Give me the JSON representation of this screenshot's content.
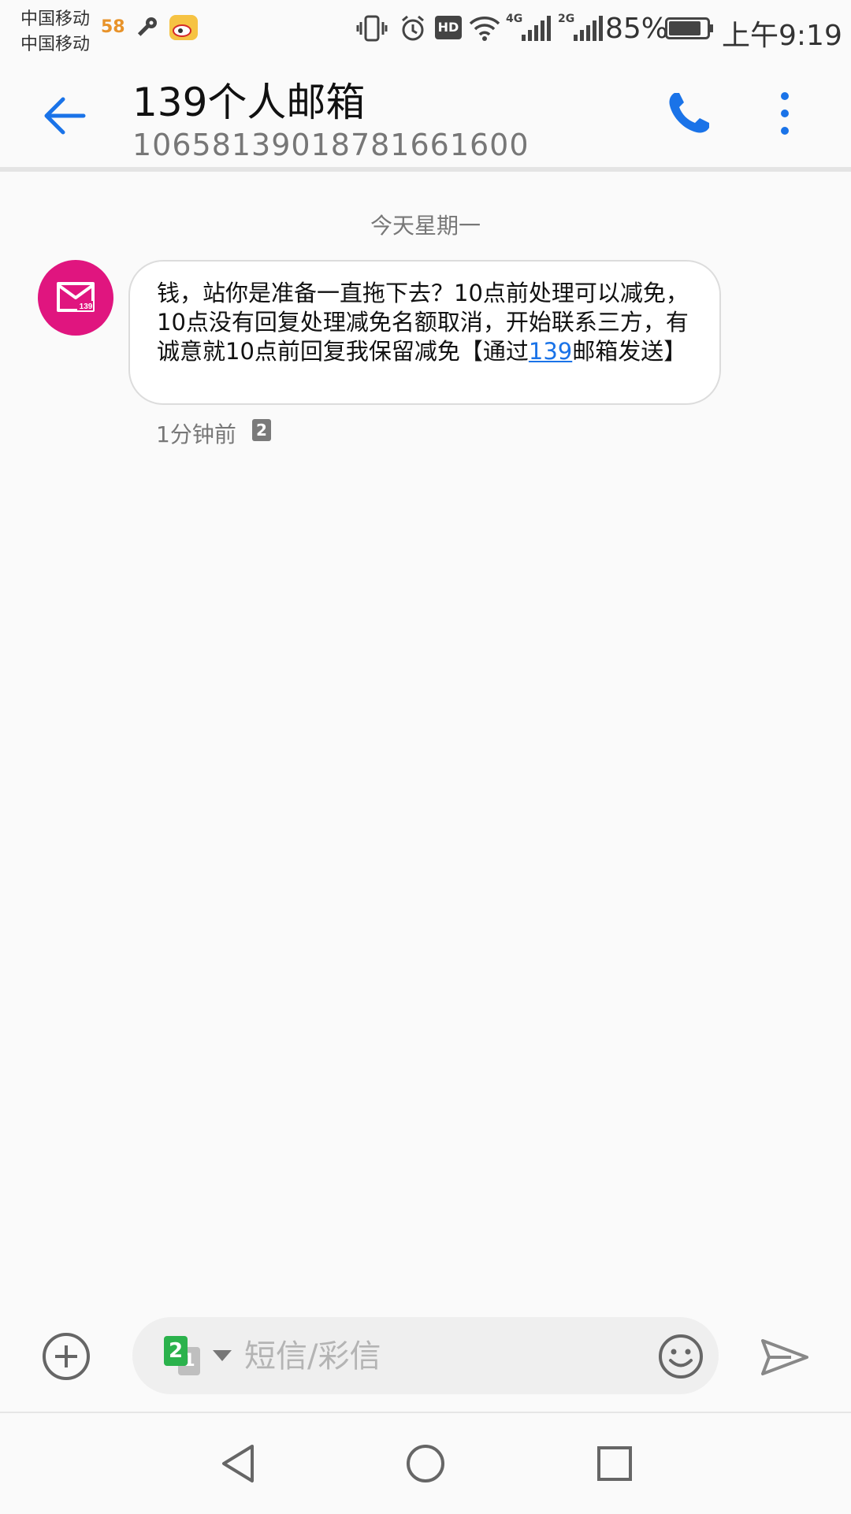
{
  "status_bar": {
    "carrier_1": "中国移动",
    "carrier_2": "中国移动",
    "app_badge": "58",
    "sim1_network": "4G",
    "sim2_network": "2G",
    "battery": "85%",
    "time": "上午9:19"
  },
  "header": {
    "title": "139个人邮箱",
    "number": "10658139018781661600"
  },
  "conversation": {
    "date_label": "今天星期一",
    "message": {
      "text_before_link": "钱，站你是准备一直拖下去？10点前处理可以减免，10点没有回复处理减免名额取消，开始联系三方，有诚意就10点前回复我保留减免【通过",
      "link_text": "139",
      "text_after_link": "邮箱发送】",
      "time": "1分钟前",
      "sim_badge": "2",
      "avatar_label": "139"
    }
  },
  "composer": {
    "placeholder": "短信/彩信",
    "sim_primary": "2",
    "sim_secondary": "1"
  },
  "colors": {
    "accent": "#1a73e8",
    "avatar_bg": "#e0157f",
    "sim_green": "#2bb24c"
  }
}
